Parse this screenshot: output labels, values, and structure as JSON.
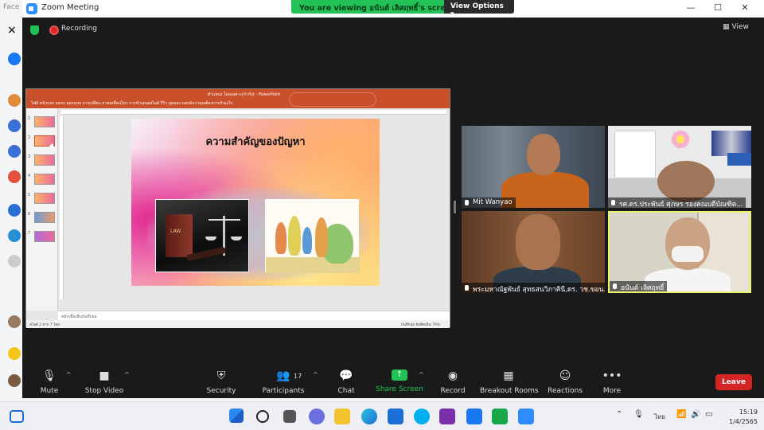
{
  "background": {
    "left_label": "Face"
  },
  "window": {
    "title": "Zoom Meeting",
    "minimize": "—",
    "maximize": "☐",
    "close": "✕"
  },
  "banner": {
    "viewing_prefix": "You are viewing",
    "viewing_name": "อนันต์ เลิศฤทธิ์'s screen",
    "view_options": "View Options ▾"
  },
  "header": {
    "recording": "Recording",
    "view": "View"
  },
  "ppt": {
    "doc_title": "ตำแหน่ง โดยเฉพาะ(กำกับ) - PowerPoint",
    "tabs": "ไฟล์   หน้าแรก   แทรก   ออกแบบ   การเปลี่ยน   ภาพเคลื่อนไหว   การนำเสนอสไลด์   รีวิว   มุมมอง   บอกฉันว่าคุณต้องการทำอะไร",
    "slide_title": "ความสำคัญของปัญหา",
    "law_label": "LAW",
    "notes_placeholder": "คลิกเพื่อเพิ่มบันทึกย่อ",
    "status_left": "สไลด์ 2 จาก 7    ไทย",
    "status_right": "บันทึกย่อ    ข้อคิดเห็น                      79%",
    "thumb_numbers": [
      "1",
      "2",
      "3",
      "4",
      "5",
      "6",
      "7"
    ]
  },
  "participants": [
    {
      "name": "Mit Wanyao"
    },
    {
      "name": "รศ.ดร.ประพันธ์ ศุภษร รองคณบดีบัณฑิต..."
    },
    {
      "name": "พระมหาณัฐพันธ์ สุทธสนวิภาคินี,ดร. วช.ขอน..."
    },
    {
      "name": "อนันต์ เลิศฤทธิ์"
    }
  ],
  "toolbar": {
    "mute": "Mute",
    "stop_video": "Stop Video",
    "security": "Security",
    "participants": "Participants",
    "participants_count": "17",
    "chat": "Chat",
    "share_screen": "Share Screen",
    "record": "Record",
    "breakout_rooms": "Breakout Rooms",
    "reactions": "Reactions",
    "more": "More",
    "leave": "Leave"
  },
  "taskbar": {
    "language": "ไทย",
    "time": "15:19",
    "date": "1/4/2565"
  },
  "colors": {
    "zoom_green": "#23c256",
    "leave_red": "#d42424",
    "ppt_orange": "#c9502b",
    "active_border": "#e8f26f"
  }
}
